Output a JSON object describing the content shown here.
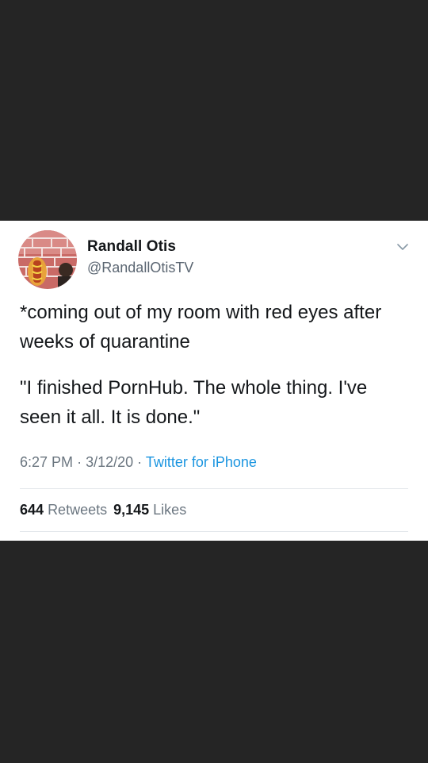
{
  "tweet": {
    "display_name": "Randall Otis",
    "handle": "@RandallOtisTV",
    "text_paragraph_1": "*coming out of my room with red eyes after weeks of quarantine",
    "text_paragraph_2": "\"I finished PornHub. The whole thing. I've seen it all. It is done.\"",
    "time": "6:27 PM",
    "date": "3/12/20",
    "separator": "·",
    "source": "Twitter for iPhone",
    "retweets_count": "644",
    "retweets_label": "Retweets",
    "likes_count": "9,145",
    "likes_label": "Likes"
  },
  "icons": {
    "menu": "chevron-down-icon",
    "avatar": "avatar-image"
  },
  "colors": {
    "background": "#252525",
    "card": "#ffffff",
    "text_primary": "#14171a",
    "text_secondary": "#6b7680",
    "link": "#1b95e0"
  }
}
